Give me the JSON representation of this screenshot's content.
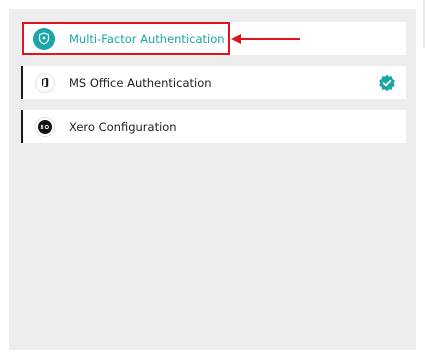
{
  "integrations": {
    "items": [
      {
        "label": "Multi-Factor Authentication",
        "icon": "shield-icon",
        "active": true,
        "verified": false
      },
      {
        "label": "MS Office Authentication",
        "icon": "ms-office-icon",
        "active": false,
        "verified": true
      },
      {
        "label": "Xero Configuration",
        "icon": "xero-icon",
        "active": false,
        "verified": false
      }
    ]
  },
  "annotation": {
    "highlight_color": "#e0141e",
    "arrow_color": "#e0141e"
  },
  "colors": {
    "accent": "#1aa6a6",
    "panel_bg": "#ededed"
  }
}
